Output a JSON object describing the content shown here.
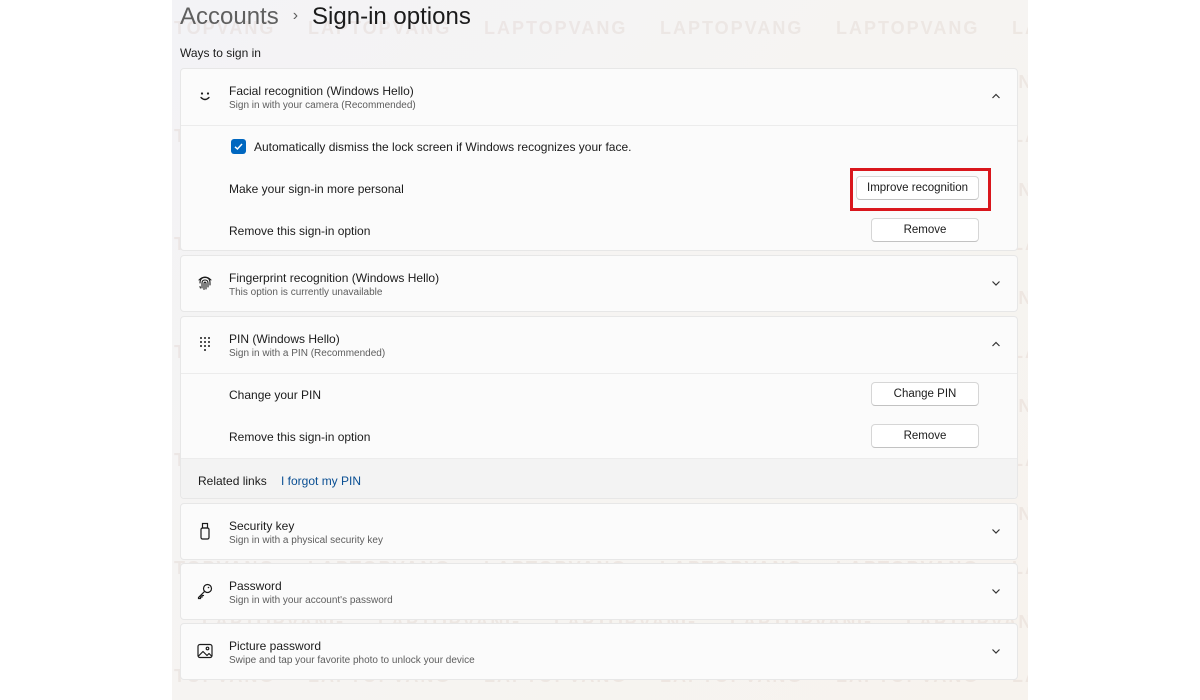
{
  "breadcrumb": {
    "parent": "Accounts",
    "separator": "›",
    "current": "Sign-in options"
  },
  "section_label": "Ways to sign in",
  "facial": {
    "title": "Facial recognition (Windows Hello)",
    "subtitle": "Sign in with your camera (Recommended)",
    "icon": "smiley-face-icon",
    "expanded": true,
    "checkbox_checked": true,
    "checkbox_label": "Automatically dismiss the lock screen if Windows recognizes your face.",
    "personal_label": "Make your sign-in more personal",
    "improve_button": "Improve recognition",
    "remove_label": "Remove this sign-in option",
    "remove_button": "Remove"
  },
  "fingerprint": {
    "title": "Fingerprint recognition (Windows Hello)",
    "subtitle": "This option is currently unavailable",
    "icon": "fingerprint-icon",
    "expanded": false
  },
  "pin": {
    "title": "PIN (Windows Hello)",
    "subtitle": "Sign in with a PIN (Recommended)",
    "icon": "keypad-icon",
    "expanded": true,
    "change_label": "Change your PIN",
    "change_button": "Change PIN",
    "remove_label": "Remove this sign-in option",
    "remove_button": "Remove",
    "related_label": "Related links",
    "related_link": "I forgot my PIN"
  },
  "security_key": {
    "title": "Security key",
    "subtitle": "Sign in with a physical security key",
    "icon": "usb-key-icon",
    "expanded": false
  },
  "password": {
    "title": "Password",
    "subtitle": "Sign in with your account's password",
    "icon": "key-icon",
    "expanded": false
  },
  "picture_password": {
    "title": "Picture password",
    "subtitle": "Swipe and tap your favorite photo to unlock your device",
    "icon": "picture-icon",
    "expanded": false
  },
  "watermark_text": "LAPTOPVANG",
  "colors": {
    "accent": "#0067c0",
    "highlight": "#d9161c",
    "link": "#0a4f93"
  }
}
